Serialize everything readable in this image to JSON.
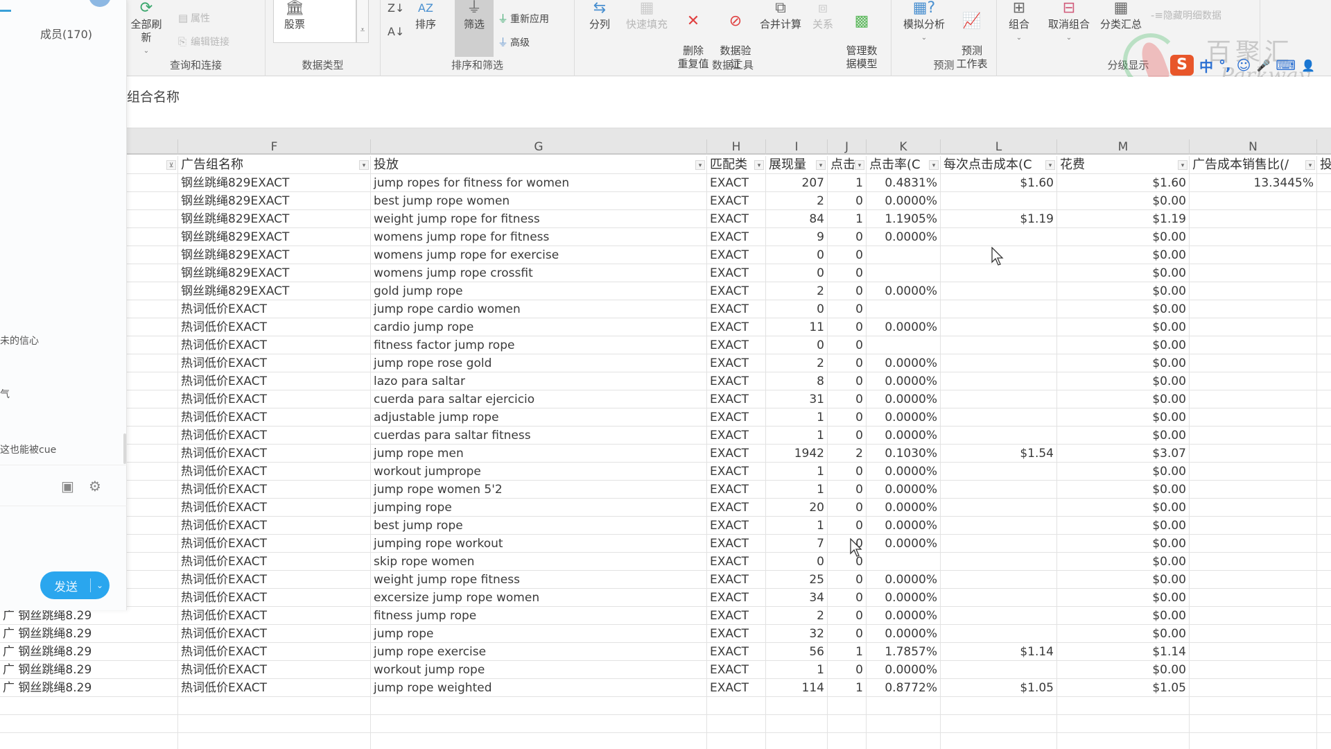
{
  "ribbon": {
    "groups": [
      {
        "label": "查询和连接",
        "buttons": [
          {
            "label": "全部刷新",
            "icon": "refresh-icon"
          }
        ],
        "small": [
          {
            "label": "属性",
            "icon": "properties-icon"
          },
          {
            "label": "编辑链接",
            "icon": "edit-links-icon"
          }
        ]
      },
      {
        "label": "数据类型",
        "buttons": [
          {
            "label": "股票",
            "icon": "stock-bank-icon"
          }
        ]
      },
      {
        "label": "排序和筛选",
        "buttons": [
          {
            "label": "排序",
            "icon": "sort-icon"
          },
          {
            "label": "筛选",
            "icon": "filter-icon"
          }
        ],
        "small": [
          {
            "label": "重新应用",
            "icon": "reapply-icon"
          },
          {
            "label": "高级",
            "icon": "advanced-filter-icon"
          }
        ]
      },
      {
        "label": "数据工具",
        "buttons": [
          {
            "label": "分列",
            "icon": "text-to-columns-icon"
          },
          {
            "label": "快速填充",
            "icon": "flash-fill-icon"
          },
          {
            "label": "删除\n重复值",
            "icon": "remove-duplicates-icon"
          },
          {
            "label": "数据验\n证",
            "icon": "data-validation-icon"
          },
          {
            "label": "合并计算",
            "icon": "consolidate-icon"
          },
          {
            "label": "关系",
            "icon": "relationships-icon"
          },
          {
            "label": "管理数\n据模型",
            "icon": "data-model-icon"
          }
        ]
      },
      {
        "label": "预测",
        "buttons": [
          {
            "label": "模拟分析",
            "icon": "what-if-icon"
          },
          {
            "label": "预测\n工作表",
            "icon": "forecast-sheet-icon"
          }
        ]
      },
      {
        "label": "分级显示",
        "buttons": [
          {
            "label": "组合",
            "icon": "group-icon"
          },
          {
            "label": "取消组合",
            "icon": "ungroup-icon"
          },
          {
            "label": "分类汇总",
            "icon": "subtotal-icon"
          }
        ],
        "small": [
          {
            "label": "隐藏明细数据",
            "icon": "hide-detail-icon"
          }
        ]
      }
    ]
  },
  "watermark": {
    "text": "百聚汇",
    "sub": "Parkway"
  },
  "ime": {
    "logo": "S",
    "items": [
      "中",
      "°,",
      "☺",
      "🎤",
      "⌨",
      "👤"
    ]
  },
  "formula_bar": {
    "text": "组合名称"
  },
  "chat": {
    "members": "成员(170)",
    "messages": [
      "未的信心",
      "气",
      "这也能被cue"
    ],
    "send_label": "发送"
  },
  "sheet": {
    "column_letters": [
      "F",
      "G",
      "H",
      "I",
      "J",
      "K",
      "L",
      "M",
      "N"
    ],
    "headers": [
      "广告组名称",
      "投放",
      "匹配类",
      "展现量",
      "点击",
      "点击率(C",
      "每次点击成本(C",
      "花费",
      "广告成本销售比(/",
      "投"
    ],
    "left_partial": [
      "广 钢丝跳绳8.29",
      "广 钢丝跳绳8.29",
      "广 钢丝跳绳8.29",
      "广 钢丝跳绳8.29",
      "广 钢丝跳绳8.29"
    ],
    "rows": [
      [
        "钢丝跳绳829EXACT",
        "jump ropes for fitness for women",
        "EXACT",
        "207",
        "1",
        "0.4831%",
        "$1.60",
        "$1.60",
        "13.3445%"
      ],
      [
        "钢丝跳绳829EXACT",
        "best jump rope women",
        "EXACT",
        "2",
        "0",
        "0.0000%",
        "",
        "$0.00",
        ""
      ],
      [
        "钢丝跳绳829EXACT",
        "weight jump rope for fitness",
        "EXACT",
        "84",
        "1",
        "1.1905%",
        "$1.19",
        "$1.19",
        ""
      ],
      [
        "钢丝跳绳829EXACT",
        "womens jump rope for fitness",
        "EXACT",
        "9",
        "0",
        "0.0000%",
        "",
        "$0.00",
        ""
      ],
      [
        "钢丝跳绳829EXACT",
        "womens jump rope for exercise",
        "EXACT",
        "0",
        "0",
        "",
        "",
        "$0.00",
        ""
      ],
      [
        "钢丝跳绳829EXACT",
        "womens jump rope crossfit",
        "EXACT",
        "0",
        "0",
        "",
        "",
        "$0.00",
        ""
      ],
      [
        "钢丝跳绳829EXACT",
        "gold jump rope",
        "EXACT",
        "2",
        "0",
        "0.0000%",
        "",
        "$0.00",
        ""
      ],
      [
        "热词低价EXACT",
        "jump rope cardio women",
        "EXACT",
        "0",
        "0",
        "",
        "",
        "$0.00",
        ""
      ],
      [
        "热词低价EXACT",
        "cardio jump rope",
        "EXACT",
        "11",
        "0",
        "0.0000%",
        "",
        "$0.00",
        ""
      ],
      [
        "热词低价EXACT",
        "fitness factor jump rope",
        "EXACT",
        "0",
        "0",
        "",
        "",
        "$0.00",
        ""
      ],
      [
        "热词低价EXACT",
        "jump rope rose gold",
        "EXACT",
        "2",
        "0",
        "0.0000%",
        "",
        "$0.00",
        ""
      ],
      [
        "热词低价EXACT",
        "lazo para saltar",
        "EXACT",
        "8",
        "0",
        "0.0000%",
        "",
        "$0.00",
        ""
      ],
      [
        "热词低价EXACT",
        "cuerda para saltar ejercicio",
        "EXACT",
        "31",
        "0",
        "0.0000%",
        "",
        "$0.00",
        ""
      ],
      [
        "热词低价EXACT",
        "adjustable jump rope",
        "EXACT",
        "1",
        "0",
        "0.0000%",
        "",
        "$0.00",
        ""
      ],
      [
        "热词低价EXACT",
        "cuerdas para saltar fitness",
        "EXACT",
        "1",
        "0",
        "0.0000%",
        "",
        "$0.00",
        ""
      ],
      [
        "热词低价EXACT",
        "jump rope men",
        "EXACT",
        "1942",
        "2",
        "0.1030%",
        "$1.54",
        "$3.07",
        ""
      ],
      [
        "热词低价EXACT",
        "workout jumprope",
        "EXACT",
        "1",
        "0",
        "0.0000%",
        "",
        "$0.00",
        ""
      ],
      [
        "热词低价EXACT",
        "jump rope women 5'2",
        "EXACT",
        "1",
        "0",
        "0.0000%",
        "",
        "$0.00",
        ""
      ],
      [
        "热词低价EXACT",
        "jumping rope",
        "EXACT",
        "20",
        "0",
        "0.0000%",
        "",
        "$0.00",
        ""
      ],
      [
        "热词低价EXACT",
        "best jump rope",
        "EXACT",
        "1",
        "0",
        "0.0000%",
        "",
        "$0.00",
        ""
      ],
      [
        "热词低价EXACT",
        "jumping rope workout",
        "EXACT",
        "7",
        "0",
        "0.0000%",
        "",
        "$0.00",
        ""
      ],
      [
        "热词低价EXACT",
        "skip rope women",
        "EXACT",
        "0",
        "0",
        "",
        "",
        "$0.00",
        ""
      ],
      [
        "热词低价EXACT",
        "weight jump rope fitness",
        "EXACT",
        "25",
        "0",
        "0.0000%",
        "",
        "$0.00",
        ""
      ],
      [
        "热词低价EXACT",
        "excersize jump rope women",
        "EXACT",
        "34",
        "0",
        "0.0000%",
        "",
        "$0.00",
        ""
      ],
      [
        "热词低价EXACT",
        "fitness jump rope",
        "EXACT",
        "2",
        "0",
        "0.0000%",
        "",
        "$0.00",
        ""
      ],
      [
        "热词低价EXACT",
        "jump rope",
        "EXACT",
        "32",
        "0",
        "0.0000%",
        "",
        "$0.00",
        ""
      ],
      [
        "热词低价EXACT",
        "jump rope exercise",
        "EXACT",
        "56",
        "1",
        "1.7857%",
        "$1.14",
        "$1.14",
        ""
      ],
      [
        "热词低价EXACT",
        "workout jump rope",
        "EXACT",
        "1",
        "0",
        "0.0000%",
        "",
        "$0.00",
        ""
      ],
      [
        "热词低价EXACT",
        "jump rope weighted",
        "EXACT",
        "114",
        "1",
        "0.8772%",
        "$1.05",
        "$1.05",
        ""
      ]
    ]
  }
}
